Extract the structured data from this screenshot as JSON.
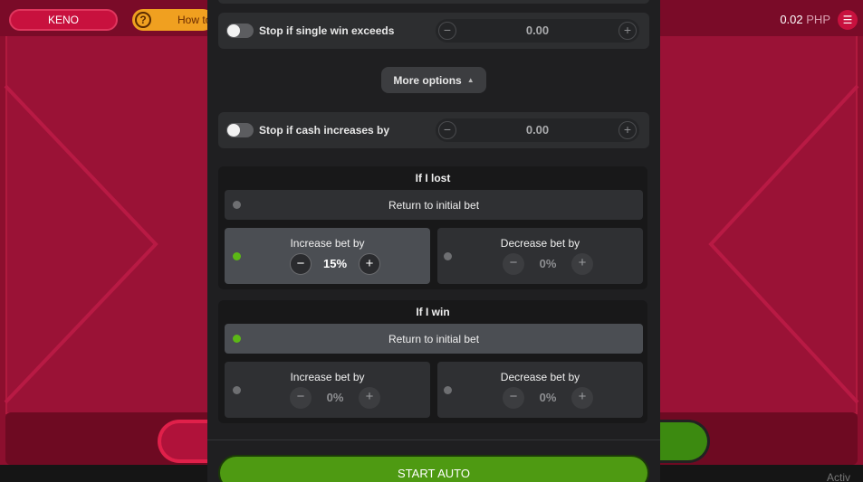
{
  "topbar": {
    "game_name": "KENO",
    "how_to_label": "How to play",
    "help_icon_glyph": "?",
    "balance_amount": "0.02",
    "balance_currency": "PHP",
    "menu_icon": "hamburger-icon"
  },
  "auto_panel": {
    "stop_single_win": {
      "label": "Stop if single win exceeds",
      "value": "0.00"
    },
    "more_options": {
      "label": "More options",
      "caret": "▲"
    },
    "stop_cash_increase": {
      "label": "Stop if cash increases by",
      "value": "0.00"
    },
    "if_lost": {
      "title": "If I lost",
      "return_label": "Return to initial bet",
      "increase_label": "Increase bet by",
      "increase_value": "15%",
      "decrease_label": "Decrease bet by",
      "decrease_value": "0%",
      "selected": "increase"
    },
    "if_win": {
      "title": "If I win",
      "return_label": "Return to initial bet",
      "increase_label": "Increase bet by",
      "increase_value": "0%",
      "decrease_label": "Decrease bet by",
      "decrease_value": "0%",
      "selected": "return"
    },
    "start_label": "START AUTO",
    "minus_glyph": "−",
    "plus_glyph": "+"
  },
  "footer": {
    "watermark": "Activ"
  },
  "colors": {
    "game_bg": "#8c0f2e",
    "panel_bg": "#1f1f21",
    "selected_dot": "#5cb816",
    "start_button": "#4e9a12"
  }
}
